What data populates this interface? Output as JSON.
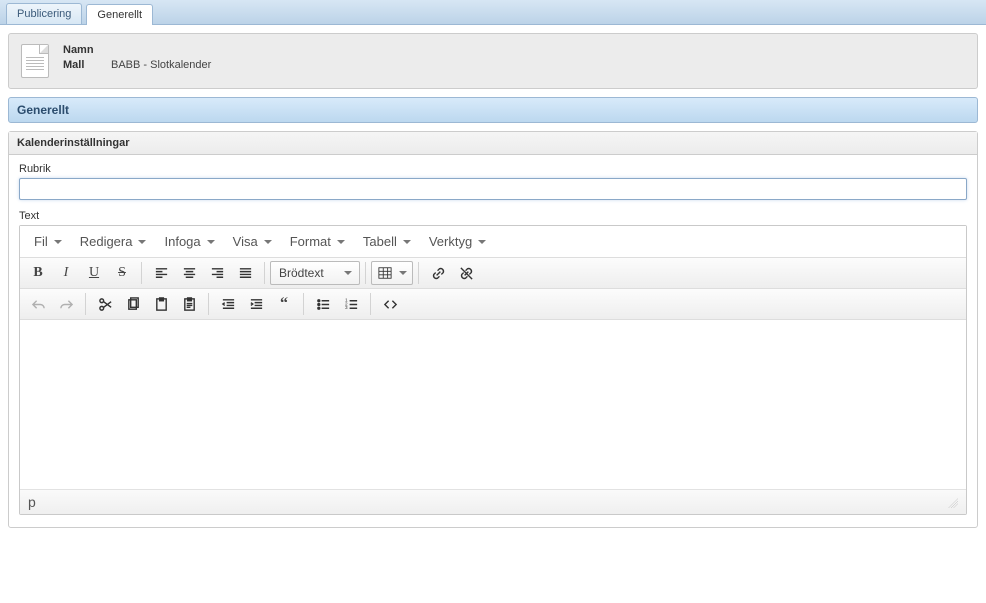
{
  "tabs": [
    {
      "label": "Publicering",
      "active": false
    },
    {
      "label": "Generellt",
      "active": true
    }
  ],
  "info": {
    "name_label": "Namn",
    "name_value": "",
    "template_label": "Mall",
    "template_value": "BABB - Slotkalender"
  },
  "section": {
    "title": "Generellt"
  },
  "subsection": {
    "title": "Kalenderinställningar"
  },
  "form": {
    "rubrik_label": "Rubrik",
    "rubrik_value": "",
    "text_label": "Text"
  },
  "editor": {
    "menu": {
      "file": "Fil",
      "edit": "Redigera",
      "insert": "Infoga",
      "view": "Visa",
      "format": "Format",
      "table": "Tabell",
      "tools": "Verktyg"
    },
    "format_select": "Brödtext",
    "status_path": "p"
  }
}
